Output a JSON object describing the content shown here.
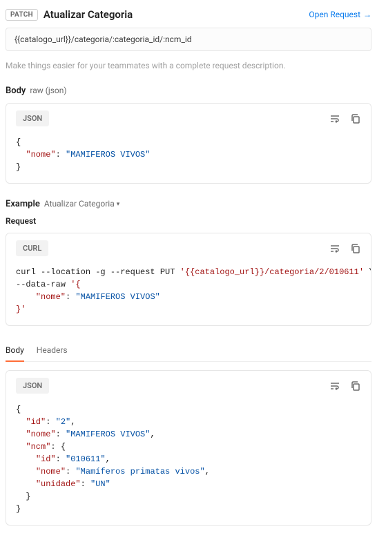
{
  "header": {
    "method": "PATCH",
    "title": "Atualizar Categoria",
    "open_request": "Open Request"
  },
  "url": "{{catalogo_url}}/categoria/:categoria_id/:ncm_id",
  "description_placeholder": "Make things easier for your teammates with a complete request description.",
  "body_section": {
    "label": "Body",
    "sub": "raw (json)",
    "lang": "JSON"
  },
  "body_json": {
    "brace_open": "{",
    "k_nome": "\"nome\"",
    "v_nome": "\"MAMIFEROS VIVOS\"",
    "brace_close": "}"
  },
  "example_section": {
    "label": "Example",
    "name": "Atualizar Categoria",
    "request_label": "Request",
    "lang": "CURL"
  },
  "curl": {
    "line1_pre": "curl --location -g --request PUT ",
    "line1_url": "'{{catalogo_url}}/categoria/2/010611'",
    "line1_post": " \\",
    "line2_pre": "--data-raw ",
    "line2_open": "'{",
    "line3_key": "    \"nome\"",
    "line3_sep": ": ",
    "line3_val": "\"MAMIFEROS VIVOS\"",
    "line4": "}'"
  },
  "tabs": {
    "body": "Body",
    "headers": "Headers"
  },
  "response": {
    "lang": "JSON",
    "brace_open": "{",
    "k_id": "\"id\"",
    "v_id": "\"2\"",
    "k_nome": "\"nome\"",
    "v_nome": "\"MAMIFEROS VIVOS\"",
    "k_ncm": "\"ncm\"",
    "ncm_open": "{",
    "k_ncm_id": "\"id\"",
    "v_ncm_id": "\"010611\"",
    "k_ncm_nome": "\"nome\"",
    "v_ncm_nome": "\"Mamíferos primatas vivos\"",
    "k_ncm_unidade": "\"unidade\"",
    "v_ncm_unidade": "\"UN\"",
    "ncm_close": "}",
    "brace_close": "}"
  }
}
